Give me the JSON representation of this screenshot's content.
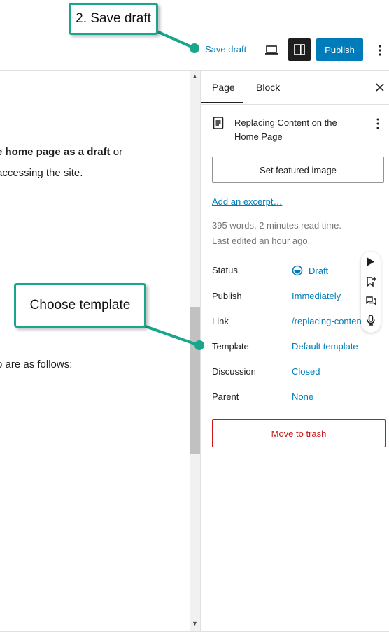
{
  "toolbar": {
    "save_draft": "Save draft",
    "publish": "Publish"
  },
  "editor": {
    "line1_bold": "e home page as a draft",
    "line1_rest": " or",
    "line2": " accessing the site.",
    "line3": "o are as follows:"
  },
  "sidebar": {
    "tabs": [
      "Page",
      "Block"
    ],
    "page_title": "Replacing Content on the Home Page",
    "featured_image": "Set featured image",
    "excerpt_link": "Add an excerpt…",
    "stats_words": "395 words, 2 minutes read time.",
    "stats_edited": "Last edited an hour ago.",
    "rows": [
      {
        "label": "Status",
        "value": "Draft"
      },
      {
        "label": "Publish",
        "value": "Immediately"
      },
      {
        "label": "Link",
        "value": "/replacing-conten"
      },
      {
        "label": "Template",
        "value": "Default template"
      },
      {
        "label": "Discussion",
        "value": "Closed"
      },
      {
        "label": "Parent",
        "value": "None"
      }
    ],
    "trash": "Move to trash"
  },
  "callouts": {
    "save_draft": "2. Save draft",
    "template": "Choose template"
  },
  "colors": {
    "accent": "#007cba",
    "callout": "#1aa58c",
    "danger": "#cc1818"
  }
}
